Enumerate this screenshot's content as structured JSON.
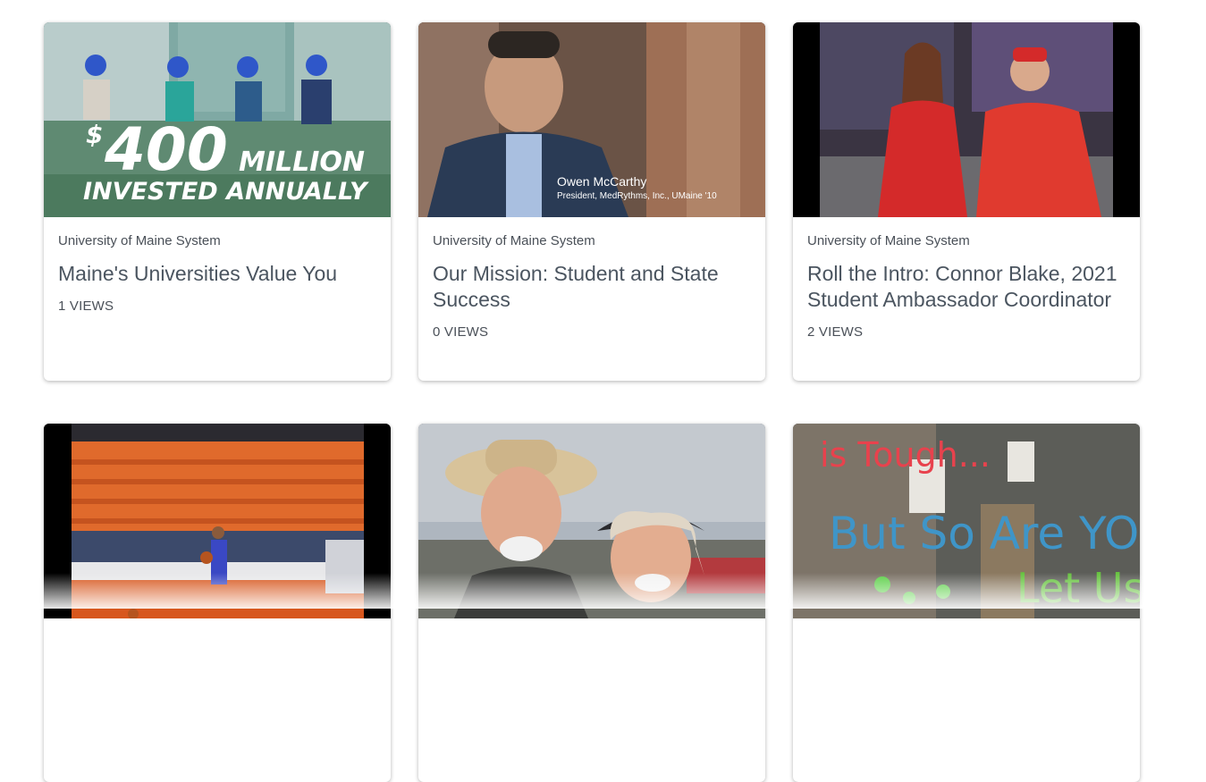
{
  "videos": [
    {
      "channel": "University of Maine System",
      "title": "Maine's Universities Value You",
      "views": "1 VIEWS",
      "overlay_dollar": "$",
      "overlay_amount": "400",
      "overlay_million": "MILLION",
      "overlay_invested": "INVESTED ANNUALLY"
    },
    {
      "channel": "University of Maine System",
      "title": "Our Mission:  Student and State Success",
      "views": "0 VIEWS",
      "caption_name": "Owen McCarthy",
      "caption_role": "President, MedRythms, Inc., UMaine '10"
    },
    {
      "channel": "University of Maine System",
      "title": "Roll the Intro:  Connor Blake, 2021 Student Ambassador Coordinator",
      "views": "2 VIEWS"
    },
    {
      "channel": "",
      "title": "",
      "views": ""
    },
    {
      "channel": "",
      "title": "",
      "views": ""
    },
    {
      "channel": "",
      "title": "",
      "views": "",
      "sign_line1": "is Tough...",
      "sign_line2": "But So Are YOU",
      "sign_line3": "Let Us"
    }
  ]
}
